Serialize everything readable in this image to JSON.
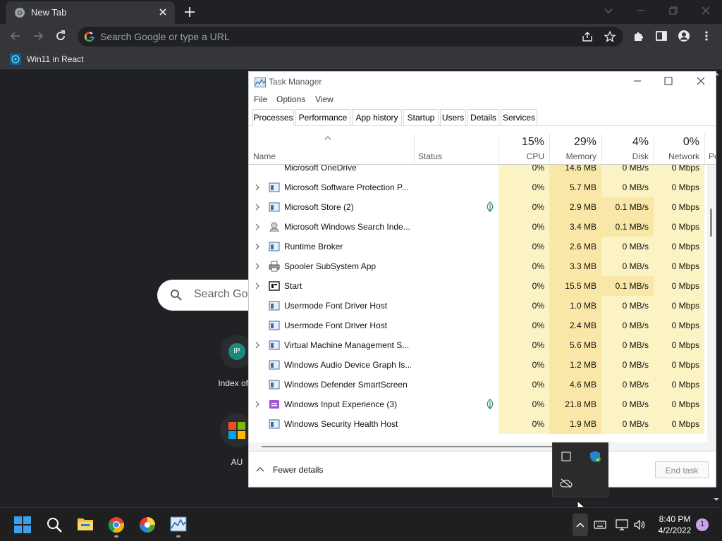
{
  "browser": {
    "tab_title": "New Tab",
    "omnibox_placeholder": "Search Google or type a URL",
    "bookmark": "Win11 in React",
    "ntp": {
      "search_placeholder": "Search Goo",
      "shortcuts": [
        {
          "initials": "IP",
          "label": "Index of /r"
        },
        {
          "initials": "",
          "label": "AU"
        }
      ]
    }
  },
  "task_manager": {
    "title": "Task Manager",
    "menu": [
      "File",
      "Options",
      "View"
    ],
    "tabs": [
      "Processes",
      "Performance",
      "App history",
      "Startup",
      "Users",
      "Details",
      "Services"
    ],
    "headers": {
      "name": "Name",
      "status": "Status",
      "cpu": {
        "pct": "15%",
        "label": "CPU"
      },
      "memory": {
        "pct": "29%",
        "label": "Memory"
      },
      "disk": {
        "pct": "4%",
        "label": "Disk"
      },
      "network": {
        "pct": "0%",
        "label": "Network"
      },
      "power": "Po"
    },
    "processes": [
      {
        "name": "Microsoft OneDrive",
        "cpu": "0%",
        "memory": "14.6 MB",
        "disk": "0 MB/s",
        "network": "0 Mbps"
      },
      {
        "name": "Microsoft Software Protection P...",
        "cpu": "0%",
        "memory": "5.7 MB",
        "disk": "0 MB/s",
        "network": "0 Mbps"
      },
      {
        "name": "Microsoft Store (2)",
        "cpu": "0%",
        "memory": "2.9 MB",
        "disk": "0.1 MB/s",
        "network": "0 Mbps"
      },
      {
        "name": "Microsoft Windows Search Inde...",
        "cpu": "0%",
        "memory": "3.4 MB",
        "disk": "0.1 MB/s",
        "network": "0 Mbps"
      },
      {
        "name": "Runtime Broker",
        "cpu": "0%",
        "memory": "2.6 MB",
        "disk": "0 MB/s",
        "network": "0 Mbps"
      },
      {
        "name": "Spooler SubSystem App",
        "cpu": "0%",
        "memory": "3.3 MB",
        "disk": "0 MB/s",
        "network": "0 Mbps"
      },
      {
        "name": "Start",
        "cpu": "0%",
        "memory": "15.5 MB",
        "disk": "0.1 MB/s",
        "network": "0 Mbps"
      },
      {
        "name": "Usermode Font Driver Host",
        "cpu": "0%",
        "memory": "1.0 MB",
        "disk": "0 MB/s",
        "network": "0 Mbps"
      },
      {
        "name": "Usermode Font Driver Host",
        "cpu": "0%",
        "memory": "2.4 MB",
        "disk": "0 MB/s",
        "network": "0 Mbps"
      },
      {
        "name": "Virtual Machine Management S...",
        "cpu": "0%",
        "memory": "5.6 MB",
        "disk": "0 MB/s",
        "network": "0 Mbps"
      },
      {
        "name": "Windows Audio Device Graph Is...",
        "cpu": "0%",
        "memory": "1.2 MB",
        "disk": "0 MB/s",
        "network": "0 Mbps"
      },
      {
        "name": "Windows Defender SmartScreen",
        "cpu": "0%",
        "memory": "4.6 MB",
        "disk": "0 MB/s",
        "network": "0 Mbps"
      },
      {
        "name": "Windows Input Experience (3)",
        "cpu": "0%",
        "memory": "21.8 MB",
        "disk": "0 MB/s",
        "network": "0 Mbps"
      },
      {
        "name": "Windows Security Health Host",
        "cpu": "0%",
        "memory": "1.9 MB",
        "disk": "0 MB/s",
        "network": "0 Mbps"
      }
    ],
    "fewer_details": "Fewer details",
    "end_task": "End task"
  },
  "taskbar": {
    "time": "8:40 PM",
    "date": "4/2/2022",
    "notification_count": "1"
  }
}
